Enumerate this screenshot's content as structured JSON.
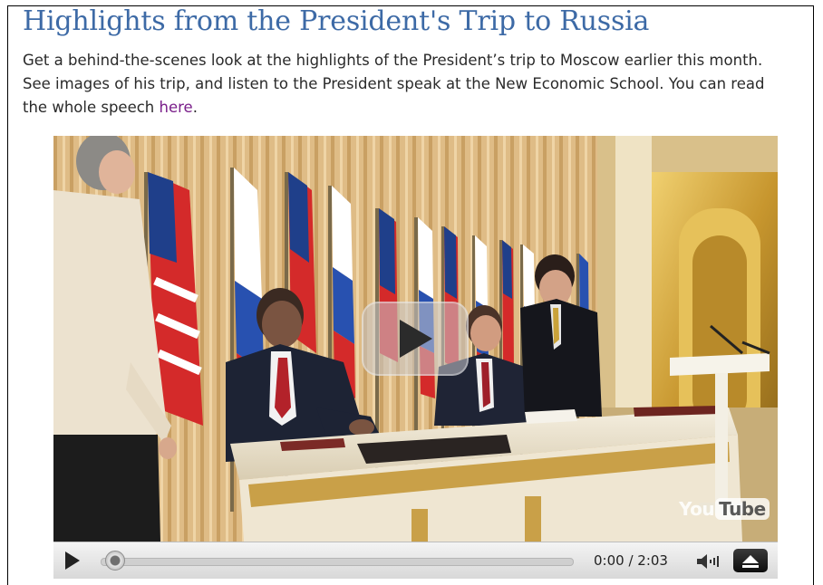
{
  "article": {
    "title": "Highlights from the President's Trip to Russia",
    "description_text": "Get a behind-the-scenes look at the highlights of the President’s trip to Moscow earlier this month. See images of his trip, and listen to the President speak at the New Economic School. You can read the whole speech ",
    "link_text": "here",
    "trailing_punct": "."
  },
  "video": {
    "watermark_you": "You",
    "watermark_tube": "Tube",
    "current_time": "0:00",
    "separator": " / ",
    "duration": "2:03",
    "progress_fraction": 0.0,
    "icons": {
      "big_play": "play-icon",
      "control_play": "play-icon",
      "volume": "volume-icon",
      "fullscreen": "fullscreen-icon"
    }
  },
  "colors": {
    "title": "#3d6aa6",
    "link": "#7a1f8a",
    "text": "#2a2a2a"
  }
}
